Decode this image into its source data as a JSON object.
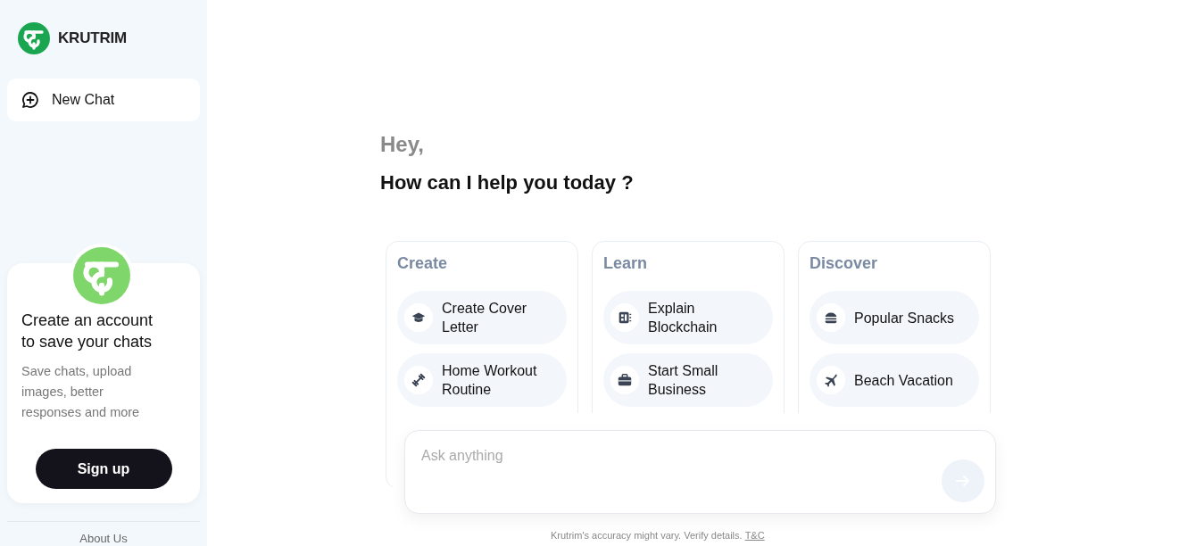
{
  "brand": {
    "name": "KRUTRIM"
  },
  "sidebar": {
    "new_chat": "New Chat",
    "signup_card": {
      "title": "Create an account to save your chats",
      "body": "Save chats, upload images, better responses and more",
      "button": "Sign up"
    },
    "footer_link": "About Us"
  },
  "greeting": "Hey,",
  "heading": "How can I help you today ?",
  "categories": [
    {
      "title": "Create",
      "suggestions": [
        {
          "label": "Create Cover Letter"
        },
        {
          "label": "Home Workout Routine"
        }
      ]
    },
    {
      "title": "Learn",
      "suggestions": [
        {
          "label": "Explain Blockchain"
        },
        {
          "label": "Start Small Business"
        }
      ]
    },
    {
      "title": "Discover",
      "suggestions": [
        {
          "label": "Popular Snacks"
        },
        {
          "label": "Beach Vacation"
        }
      ]
    }
  ],
  "input": {
    "placeholder": "Ask anything"
  },
  "disclaimer": {
    "text": "Krutrim's accuracy might vary. Verify details.",
    "link": "T&C"
  }
}
